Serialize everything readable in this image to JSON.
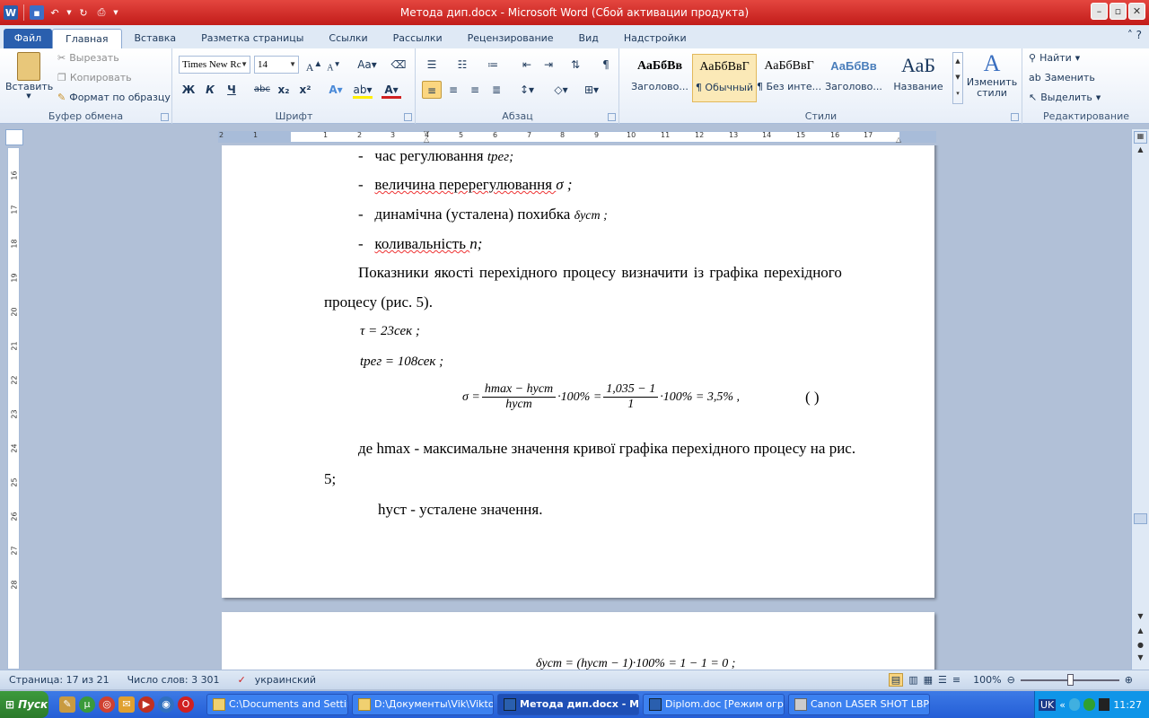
{
  "window": {
    "title": "Метода дип.docx  -  Microsoft Word (Сбой активации продукта)"
  },
  "tabs": [
    "Файл",
    "Главная",
    "Вставка",
    "Разметка страницы",
    "Ссылки",
    "Рассылки",
    "Рецензирование",
    "Вид",
    "Надстройки"
  ],
  "clipboard": {
    "paste": "Вставить",
    "cut": "Вырезать",
    "copy": "Копировать",
    "format_painter": "Формат по образцу",
    "label": "Буфер обмена"
  },
  "font": {
    "name": "Times New Rc",
    "size": "14",
    "bold": "Ж",
    "italic": "К",
    "underline": "Ч",
    "strike": "abc",
    "label": "Шрифт"
  },
  "paragraph": {
    "label": "Абзац"
  },
  "styles": {
    "items": [
      {
        "sample": "АаБбВв",
        "name": "Заголово..."
      },
      {
        "sample": "АаБбВвГ",
        "name": "¶ Обычный"
      },
      {
        "sample": "АаБбВвГ",
        "name": "¶ Без инте..."
      },
      {
        "sample": "АаБбВв",
        "name": "Заголово..."
      },
      {
        "sample": "АаБ",
        "name": "Название"
      }
    ],
    "change": "Изменить стили",
    "label": "Стили"
  },
  "editing": {
    "find": "Найти",
    "replace": "Заменить",
    "select": "Выделить",
    "label": "Редактирование"
  },
  "ruler": {
    "h_numbers": [
      "2",
      "1",
      "1",
      "2",
      "3",
      "4",
      "5",
      "6",
      "7",
      "8",
      "9",
      "10",
      "11",
      "12",
      "13",
      "14",
      "15",
      "16",
      "17"
    ],
    "v_numbers": [
      "16",
      "17",
      "18",
      "19",
      "20",
      "21",
      "22",
      "23",
      "24",
      "25",
      "26",
      "27",
      "28"
    ]
  },
  "document": {
    "bullets": [
      {
        "text": "час регулювання ",
        "math": "tрег;"
      },
      {
        "text": "величина перерегулювання ",
        "math": "σ ;"
      },
      {
        "text": "динамічна (усталена) похибка ",
        "math": "δуст ;"
      },
      {
        "text": "коливальність ",
        "math": "n;"
      }
    ],
    "para1_line1": "Показники якості перехідного процесу визначити із графіка перехідного",
    "para1_line2": "процесу (рис. 5).",
    "tau": "τ = 23сек ;",
    "treg": "tрег = 108сек ;",
    "formula": {
      "lhs": "σ =",
      "num1": "hmax − hуст",
      "den1": "hуст",
      "mid": "·100% =",
      "num2": "1,035 − 1",
      "den2": "1",
      "rhs": "·100% = 3,5% ,",
      "number": "(        )"
    },
    "where_line1": "де hmax  - максимальне значення кривої графіка перехідного процесу на рис.",
    "where_line2": "5;",
    "hust": "hуст  - усталене значення.",
    "next_page_formula": "δуст = (hуст − 1)·100% = 1 − 1 = 0 ;"
  },
  "status": {
    "page": "Страница: 17 из 21",
    "words": "Число слов: 3 301",
    "language": "украинский",
    "zoom": "100%"
  },
  "taskbar": {
    "start": "Пуск",
    "tasks": [
      "C:\\Documents and Settin...",
      "D:\\Документы\\Vik\\Vikto...",
      "Метода дип.docx - M...",
      "Diplom.doc [Режим огра...",
      "Canon LASER SHOT LBP-..."
    ],
    "lang": "UK",
    "clock": "11:27"
  }
}
